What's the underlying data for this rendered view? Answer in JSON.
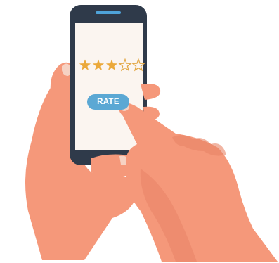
{
  "rating": {
    "value": 3,
    "max": 5,
    "filled_color": "#EBA93A",
    "empty_color": "#E3A743"
  },
  "rate_button": {
    "label": "RATE",
    "color": "#5BA8D4"
  },
  "phone": {
    "body_color": "#2F3A4A",
    "screen_color": "#FBF5F0",
    "speaker_color": "#4FA3D9"
  },
  "hands": {
    "skin_color": "#F5987A",
    "skin_shade_color": "#E88466",
    "nail_color": "#F6D2C3"
  }
}
